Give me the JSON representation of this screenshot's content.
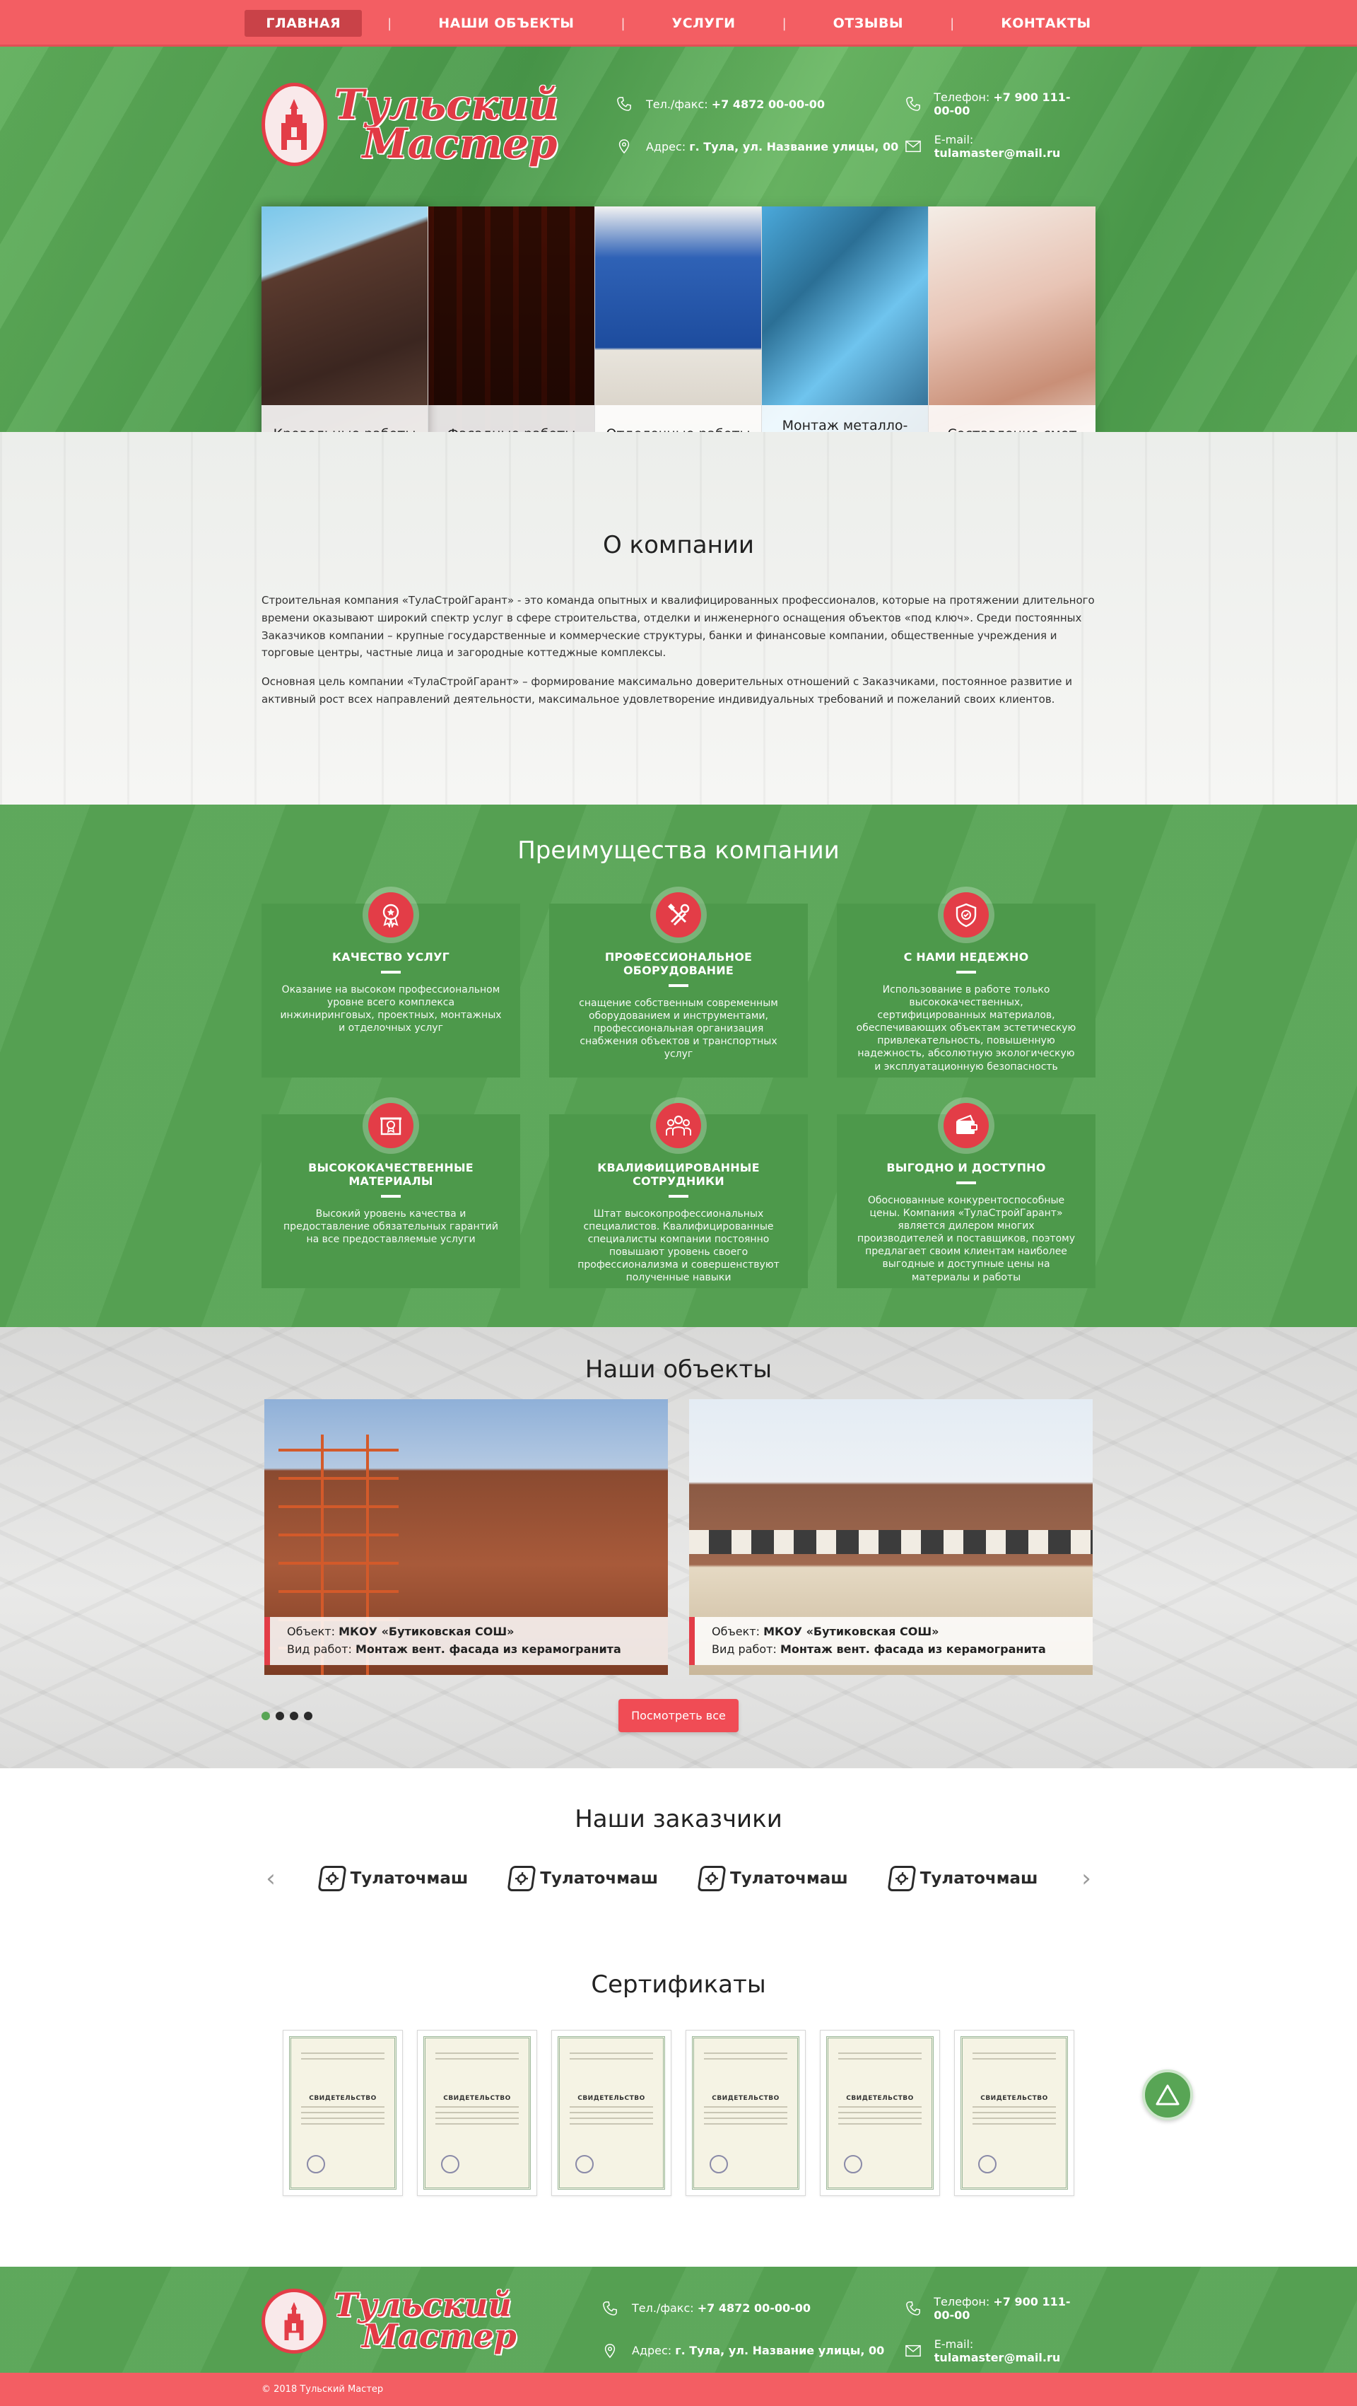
{
  "nav": {
    "items": [
      {
        "label": "ГЛАВНАЯ",
        "active": true
      },
      {
        "label": "НАШИ ОБЪЕКТЫ"
      },
      {
        "label": "УСЛУГИ"
      },
      {
        "label": "ОТЗЫВЫ"
      },
      {
        "label": "КОНТАКТЫ"
      }
    ],
    "separator": "|"
  },
  "brand": {
    "line1": "Тульский",
    "line2": "Мастер"
  },
  "contacts": {
    "phone_fax_label": "Тел./факс:",
    "phone_fax": "+7 4872 00-00-00",
    "phone_label": "Телефон:",
    "phone": "+7 900 111-00-00",
    "address_label": "Адрес:",
    "address": "г. Тула, ул. Название улицы, 00",
    "email_label": "E-mail:",
    "email": "tulamaster@mail.ru"
  },
  "services": [
    {
      "label": "Кровельные работы"
    },
    {
      "label": "Фасадные работы"
    },
    {
      "label": "Отделочные работы"
    },
    {
      "label": "Монтаж металло-конструкций"
    },
    {
      "label": "Составление смет"
    }
  ],
  "about": {
    "title": "О компании",
    "p1": "Строительная компания «ТулаСтройГарант» - это команда опытных и квалифицированных профессионалов, которые на протяжении длительного времени оказывают широкий спектр услуг в сфере строительства, отделки и инженерного оснащения объектов «под ключ». Среди постоянных Заказчиков компании – крупные государственные и коммерческие структуры, банки и финансовые компании, общественные учреждения и торговые центры, частные лица и загородные коттеджные комплексы.",
    "p2": "Основная цель компании «ТулаСтройГарант» – формирование максимально доверительных отношений с Заказчиками, постоянное развитие и активный рост всех направлений деятельности, максимальное удовлетворение индивидуальных требований и пожеланий своих клиентов."
  },
  "advantages": {
    "title": "Преимущества компании",
    "items": [
      {
        "icon": "medal-icon",
        "title": "КАЧЕСТВО УСЛУГ",
        "text": "Оказание на высоком профессиональном уровне всего комплекса инжиниринговых, проектных, монтажных и отделочных услуг"
      },
      {
        "icon": "tools-icon",
        "title": "ПРОФЕССИОНАЛЬНОЕ ОБОРУДОВАНИЕ",
        "text": "снащение собственным современным оборудованием и инструментами, профессиональная организация снабжения объектов и транспортных услуг"
      },
      {
        "icon": "shield-icon",
        "title": "С НАМИ НЕДЕЖНО",
        "text": "Использование в работе только высококачественных, сертифицированных материалов, обеспечивающих объектам эстетическую привлекательность, повышенную надежность, абсолютную экологическую и эксплуатационную безопасность"
      },
      {
        "icon": "box-medal-icon",
        "title": "ВЫСОКОКАЧЕСТВЕННЫЕ МАТЕРИАЛЫ",
        "text": "Высокий уровень качества и предоставление обязательных гарантий на все предоставляемые услуги"
      },
      {
        "icon": "team-icon",
        "title": "КВАЛИФИЦИРОВАННЫЕ СОТРУДНИКИ",
        "text": "Штат высокопрофессиональных специалистов. Квалифицированные специалисты компании постоянно повышают уровень своего профессионализма и совершенствуют полученные навыки"
      },
      {
        "icon": "wallet-icon",
        "title": "ВЫГОДНО И ДОСТУПНО",
        "text": "Обоснованные конкурентоспособные цены. Компания «ТулаСтройГарант» является дилером многих производителей и поставщиков, поэтому предлагает своим клиентам наиболее выгодные и доступные цены на материалы и работы"
      }
    ]
  },
  "objects": {
    "title": "Наши объекты",
    "object_label": "Объект:",
    "work_label": "Вид работ:",
    "items": [
      {
        "object": "МКОУ «Бутиковская СОШ»",
        "work": "Монтаж вент. фасада из керамогранита"
      },
      {
        "object": "МКОУ «Бутиковская СОШ»",
        "work": "Монтаж вент. фасада из керамогранита"
      }
    ],
    "button": "Посмотреть все",
    "slides_total": 4,
    "active_slide": 1
  },
  "clients": {
    "title": "Наши заказчики",
    "items": [
      {
        "name": "Тулаточмаш"
      },
      {
        "name": "Тулаточмаш"
      },
      {
        "name": "Тулаточмаш"
      },
      {
        "name": "Тулаточмаш"
      }
    ]
  },
  "certificates": {
    "title": "Сертификаты",
    "items": [
      {
        "heading": "СВИДЕТЕЛЬСТВО"
      },
      {
        "heading": "СВИДЕТЕЛЬСТВО"
      },
      {
        "heading": "СВИДЕТЕЛЬСТВО"
      },
      {
        "heading": "СВИДЕТЕЛЬСТВО"
      },
      {
        "heading": "СВИДЕТЕЛЬСТВО"
      },
      {
        "heading": "СВИДЕТЕЛЬСТВО"
      }
    ]
  },
  "footer": {
    "copyright": "© 2018  Тульский Мастер"
  },
  "colors": {
    "red": "#f35e63",
    "green": "#58a555",
    "accent_red": "#e33d47"
  }
}
